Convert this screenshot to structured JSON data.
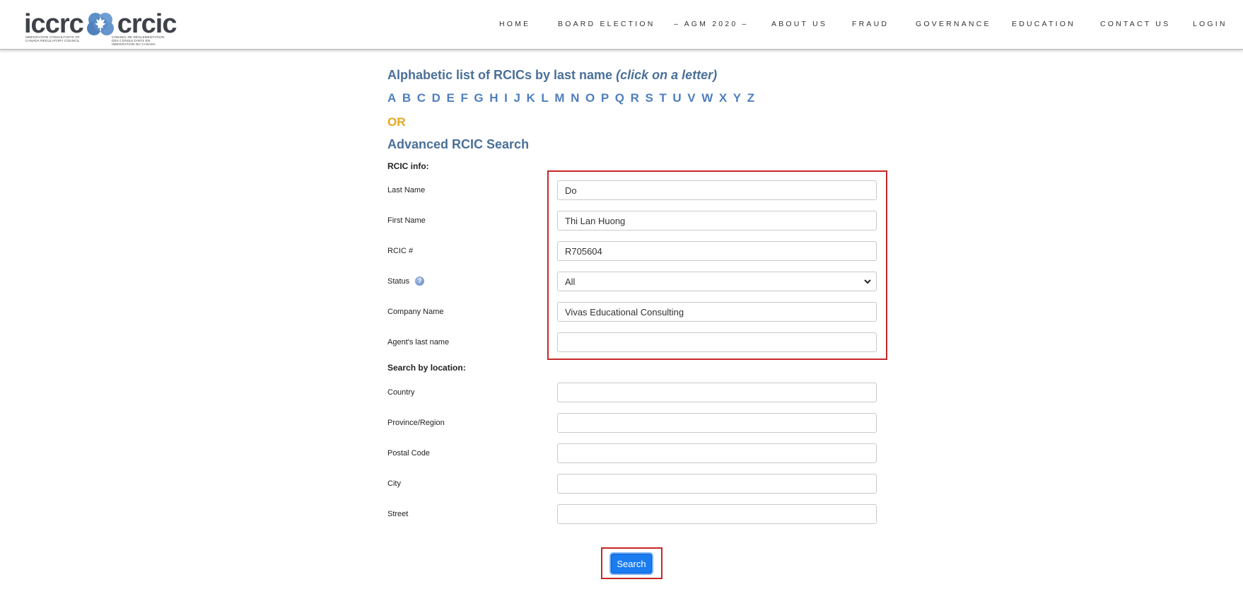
{
  "logo": {
    "left_word": "iccrc",
    "right_word": "crcic",
    "left_sub": "IMMIGRATION CONSULTANTS OF CANADA REGULATORY COUNCIL",
    "right_sub": "CONSEIL DE RÉGLEMENTATION DES CONSULTANTS EN IMMIGRATION DU CANADA",
    "brand_color": "#5b8fc7"
  },
  "nav": {
    "items": [
      "HOME",
      "BOARD ELECTION",
      "– AGM 2020 –",
      "ABOUT US",
      "FRAUD",
      "GOVERNANCE",
      "EDUCATION",
      "CONTACT US",
      "LOGIN"
    ]
  },
  "alphabetic": {
    "title": "Alphabetic list of RCICs by last name ",
    "hint": "(click on a letter)",
    "letters": [
      "A",
      "B",
      "C",
      "D",
      "E",
      "F",
      "G",
      "H",
      "I",
      "J",
      "K",
      "L",
      "M",
      "N",
      "O",
      "P",
      "Q",
      "R",
      "S",
      "T",
      "U",
      "V",
      "W",
      "X",
      "Y",
      "Z"
    ]
  },
  "or_label": "OR",
  "advanced": {
    "title": "Advanced RCIC Search",
    "rcic_info_label": "RCIC info:",
    "location_label": "Search by location:",
    "fields": {
      "last_name": {
        "label": "Last Name",
        "value": "Do"
      },
      "first_name": {
        "label": "First Name",
        "value": "Thi Lan Huong"
      },
      "rcic_number": {
        "label": "RCIC #",
        "value": "R705604"
      },
      "status": {
        "label": "Status",
        "value": "All"
      },
      "company_name": {
        "label": "Company Name",
        "value": "Vivas Educational Consulting"
      },
      "agent_last_name": {
        "label": "Agent's last name",
        "value": ""
      },
      "country": {
        "label": "Country",
        "value": ""
      },
      "province": {
        "label": "Province/Region",
        "value": ""
      },
      "postal_code": {
        "label": "Postal Code",
        "value": ""
      },
      "city": {
        "label": "City",
        "value": ""
      },
      "street": {
        "label": "Street",
        "value": ""
      }
    },
    "search_label": "Search"
  },
  "colors": {
    "heading": "#4a7099",
    "letter_link": "#4f7fbf",
    "or_accent": "#e5a81e",
    "highlight": "#c62828",
    "button": "#1a7cf0"
  }
}
